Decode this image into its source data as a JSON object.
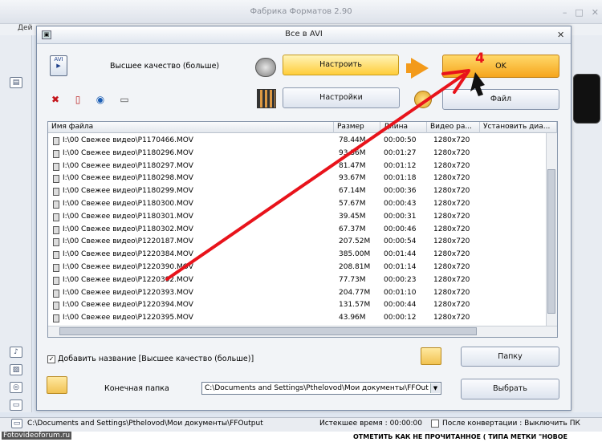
{
  "app": {
    "title": "Фабрика Форматов 2.90",
    "menu_first": "Дей",
    "window_buttons": [
      "–",
      "□",
      "✕"
    ]
  },
  "dialog": {
    "title": "Все в AVI",
    "close": "✕",
    "quality_label": "Высшее качество (больше)",
    "configure_button": "Настроить",
    "settings_button": "Настройки",
    "ok_button": "OK",
    "file_button": "Файл",
    "tools": {
      "delete": "✖",
      "clear": "▯",
      "play": "◉",
      "info": "▭"
    },
    "list": {
      "columns": [
        "Имя файла",
        "Размер",
        "Длина",
        "Видео ра...",
        "Установить диа..."
      ],
      "rows": [
        {
          "name": "I:\\00 Свежее видео\\P1170466.MOV",
          "size": "78.44M",
          "length": "00:00:50",
          "video": "1280x720"
        },
        {
          "name": "I:\\00 Свежее видео\\P1180296.MOV",
          "size": "93.36M",
          "length": "00:01:27",
          "video": "1280x720"
        },
        {
          "name": "I:\\00 Свежее видео\\P1180297.MOV",
          "size": "81.47M",
          "length": "00:01:12",
          "video": "1280x720"
        },
        {
          "name": "I:\\00 Свежее видео\\P1180298.MOV",
          "size": "93.67M",
          "length": "00:01:18",
          "video": "1280x720"
        },
        {
          "name": "I:\\00 Свежее видео\\P1180299.MOV",
          "size": "67.14M",
          "length": "00:00:36",
          "video": "1280x720"
        },
        {
          "name": "I:\\00 Свежее видео\\P1180300.MOV",
          "size": "57.67M",
          "length": "00:00:43",
          "video": "1280x720"
        },
        {
          "name": "I:\\00 Свежее видео\\P1180301.MOV",
          "size": "39.45M",
          "length": "00:00:31",
          "video": "1280x720"
        },
        {
          "name": "I:\\00 Свежее видео\\P1180302.MOV",
          "size": "67.37M",
          "length": "00:00:46",
          "video": "1280x720"
        },
        {
          "name": "I:\\00 Свежее видео\\P1220187.MOV",
          "size": "207.52M",
          "length": "00:00:54",
          "video": "1280x720"
        },
        {
          "name": "I:\\00 Свежее видео\\P1220384.MOV",
          "size": "385.00M",
          "length": "00:01:44",
          "video": "1280x720"
        },
        {
          "name": "I:\\00 Свежее видео\\P1220390.MOV",
          "size": "208.81M",
          "length": "00:01:14",
          "video": "1280x720"
        },
        {
          "name": "I:\\00 Свежее видео\\P1220392.MOV",
          "size": "77.73M",
          "length": "00:00:23",
          "video": "1280x720"
        },
        {
          "name": "I:\\00 Свежее видео\\P1220393.MOV",
          "size": "204.77M",
          "length": "00:01:10",
          "video": "1280x720"
        },
        {
          "name": "I:\\00 Свежее видео\\P1220394.MOV",
          "size": "131.57M",
          "length": "00:00:44",
          "video": "1280x720"
        },
        {
          "name": "I:\\00 Свежее видео\\P1220395.MOV",
          "size": "43.96M",
          "length": "00:00:12",
          "video": "1280x720"
        }
      ]
    },
    "add_name_checked": true,
    "add_name_label": "Добавить название [Высшее качество (больше)]",
    "folder_button": "Папку",
    "dest_label": "Конечная папка",
    "dest_path": "C:\\Documents and Settings\\Pthelovod\\Мои документы\\FFOut",
    "choose_button": "Выбрать"
  },
  "status": {
    "path": "C:\\Documents and Settings\\Pthelovod\\Мои документы\\FFOutput",
    "elapsed": "Истекшее время : 00:00:00",
    "after": "После конвертации : Выключить ПК"
  },
  "footer": {
    "watermark": "Fotovideoforum.ru",
    "text": "ОТМЕТИТЬ КАК НЕ ПРОЧИТАННОЕ ( ТИПА МЕТКИ \"НОВОЕ"
  },
  "annotation": {
    "number": "4",
    "color": "#e8131b"
  }
}
